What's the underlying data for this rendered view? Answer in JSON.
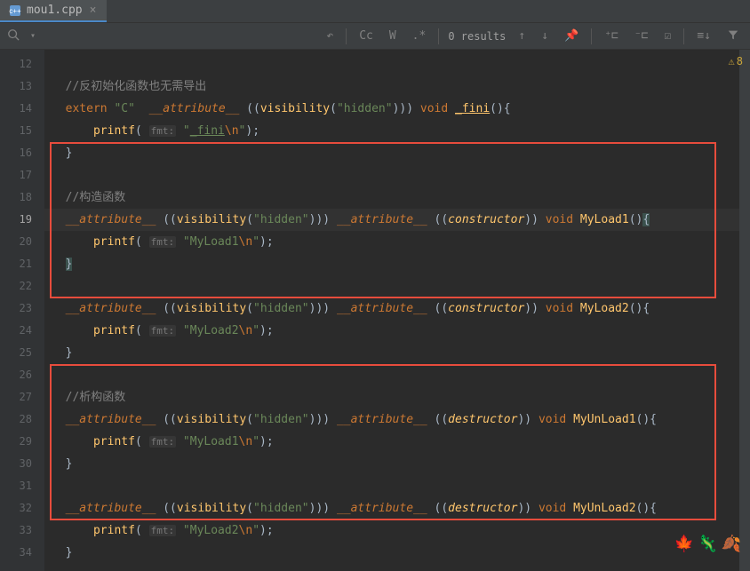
{
  "tab": {
    "filename": "mou1.cpp",
    "icon": "cpp-file-icon"
  },
  "search": {
    "results_text": "0 results"
  },
  "warning": {
    "count": "8"
  },
  "gutter": {
    "start": 12,
    "end": 34,
    "current": 19
  },
  "code": {
    "l12": "",
    "l13": {
      "comment": "//反初始化函数也无需导出"
    },
    "l14": {
      "extern": "extern",
      "c": "\"C\"",
      "attr": "__attribute__",
      "vis": "visibility",
      "hidden": "\"hidden\"",
      "void": "void",
      "fn": "_fini"
    },
    "l15": {
      "printf": "printf",
      "hint": "fmt:",
      "str1": "\"",
      "str2": "_fini",
      "esc": "\\n",
      "str3": "\""
    },
    "l16": "}",
    "l17": "",
    "l18": {
      "comment": "//构造函数"
    },
    "l19": {
      "attr": "__attribute__",
      "vis": "visibility",
      "hidden": "\"hidden\"",
      "ctor": "constructor",
      "void": "void",
      "fn": "MyLoad1"
    },
    "l20": {
      "printf": "printf",
      "hint": "fmt:",
      "str1": "\"MyLoad1",
      "esc": "\\n",
      "str3": "\""
    },
    "l21": "}",
    "l22": "",
    "l23": {
      "attr": "__attribute__",
      "vis": "visibility",
      "hidden": "\"hidden\"",
      "ctor": "constructor",
      "void": "void",
      "fn": "MyLoad2"
    },
    "l24": {
      "printf": "printf",
      "hint": "fmt:",
      "str1": "\"MyLoad2",
      "esc": "\\n",
      "str3": "\""
    },
    "l25": "}",
    "l26": "",
    "l27": {
      "comment": "//析构函数"
    },
    "l28": {
      "attr": "__attribute__",
      "vis": "visibility",
      "hidden": "\"hidden\"",
      "dtor": "destructor",
      "void": "void",
      "fn": "MyUnLoad1"
    },
    "l29": {
      "printf": "printf",
      "hint": "fmt:",
      "str1": "\"MyLoad1",
      "esc": "\\n",
      "str3": "\""
    },
    "l30": "}",
    "l31": "",
    "l32": {
      "attr": "__attribute__",
      "vis": "visibility",
      "hidden": "\"hidden\"",
      "dtor": "destructor",
      "void": "void",
      "fn": "MyUnLoad2"
    },
    "l33": {
      "printf": "printf",
      "hint": "fmt:",
      "str1": "\"MyLoad2",
      "esc": "\\n",
      "str3": "\""
    },
    "l34": "}"
  },
  "toolbar_labels": {
    "cc": "Cc",
    "w": "W",
    "regex": ".*"
  }
}
